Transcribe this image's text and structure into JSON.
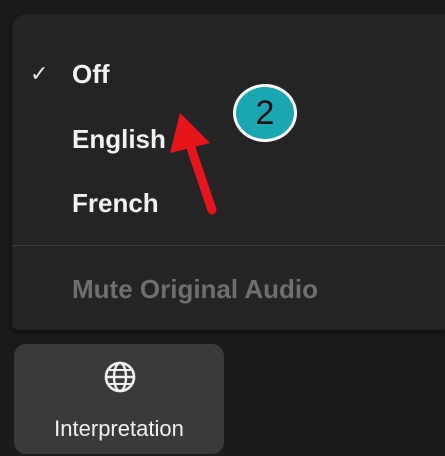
{
  "interpretation_menu": {
    "items": [
      {
        "label": "Off",
        "checked": true,
        "check_glyph": "✓",
        "enabled": true
      },
      {
        "label": "English",
        "checked": false,
        "enabled": true
      },
      {
        "label": "French",
        "checked": false,
        "enabled": true
      }
    ],
    "mute_original_audio": {
      "label": "Mute Original Audio",
      "enabled": false
    }
  },
  "annotation": {
    "step_number": "2",
    "badge_color": "#1aa7b2",
    "arrow_color": "#e8141b"
  },
  "toolbar": {
    "interpretation_button": {
      "label": "Interpretation",
      "icon": "globe-icon"
    }
  }
}
